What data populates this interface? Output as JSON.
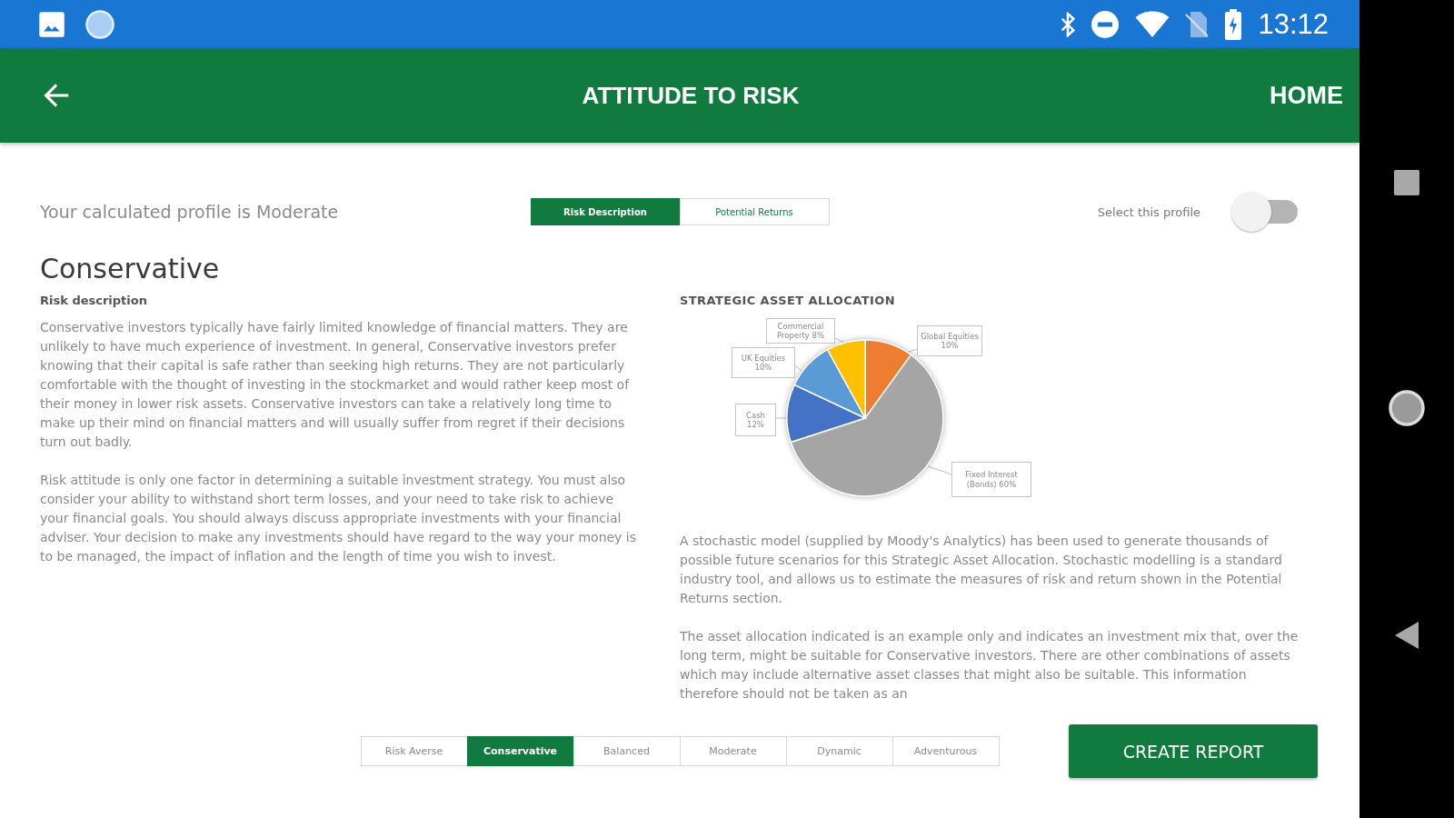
{
  "status_bar": {
    "time": "13:12"
  },
  "app_bar": {
    "title": "ATTITUDE TO RISK",
    "action": "HOME"
  },
  "profile_row": {
    "calculated_profile": "Your calculated profile is Moderate",
    "view_tabs": [
      {
        "label": "Risk Description",
        "selected": true
      },
      {
        "label": "Potential Returns",
        "selected": false
      }
    ],
    "select_profile": {
      "label": "Select this profile",
      "on": false
    }
  },
  "risk_panel": {
    "title": "Conservative",
    "subtitle": "Risk description",
    "paragraphs": [
      "Conservative investors typically have fairly limited knowledge of financial matters. They are unlikely to have much experience of investment. In general, Conservative investors prefer knowing that their capital is safe rather than seeking high returns. They are not particularly comfortable with the thought of investing in the stockmarket and would rather keep most of their money in lower risk assets. Conservative investors can take a relatively long time to make up their mind on financial matters and will usually suffer from regret if their decisions turn out badly.",
      "Risk attitude is only one factor in determining a suitable investment strategy. You must also consider your ability to withstand short term losses, and your need to take risk to achieve your financial goals. You should always discuss appropriate investments with your financial adviser. Your decision to make any investments should have regard to the way your money is to be managed, the impact of inflation and the length of time you wish to invest."
    ]
  },
  "allocation_panel": {
    "chart_data": {
      "type": "pie",
      "title": "STRATEGIC ASSET ALLOCATION",
      "categories": [
        "Global Equities",
        "Fixed Interest (Bonds)",
        "Cash",
        "UK Equities",
        "Commercial Property"
      ],
      "values": [
        10,
        60,
        12,
        10,
        8
      ],
      "colors": [
        "#ed7d31",
        "#a5a5a5",
        "#4472c4",
        "#5b9bd5",
        "#ffc000"
      ],
      "data_labels": true,
      "value_labels": [
        "10%",
        "60%",
        "12%",
        "10%",
        "8%"
      ]
    },
    "paragraphs": [
      "A stochastic model (supplied by Moody's Analytics) has been used to generate thousands of possible future scenarios for this Strategic Asset Allocation. Stochastic modelling is a standard industry tool, and allows us to estimate the measures of risk and return shown in the Potential Returns section.",
      "The asset allocation indicated is an example only and indicates an investment mix that, over the long term, might be suitable for Conservative investors. There are other combinations of assets which may include alternative asset classes that might also be suitable. This information therefore should not be taken as an"
    ]
  },
  "profile_tabs": [
    {
      "label": "Risk Averse",
      "selected": false
    },
    {
      "label": "Conservative",
      "selected": true
    },
    {
      "label": "Balanced",
      "selected": false
    },
    {
      "label": "Moderate",
      "selected": false
    },
    {
      "label": "Dynamic",
      "selected": false
    },
    {
      "label": "Adventurous",
      "selected": false
    }
  ],
  "create_report_button": "CREATE REPORT"
}
